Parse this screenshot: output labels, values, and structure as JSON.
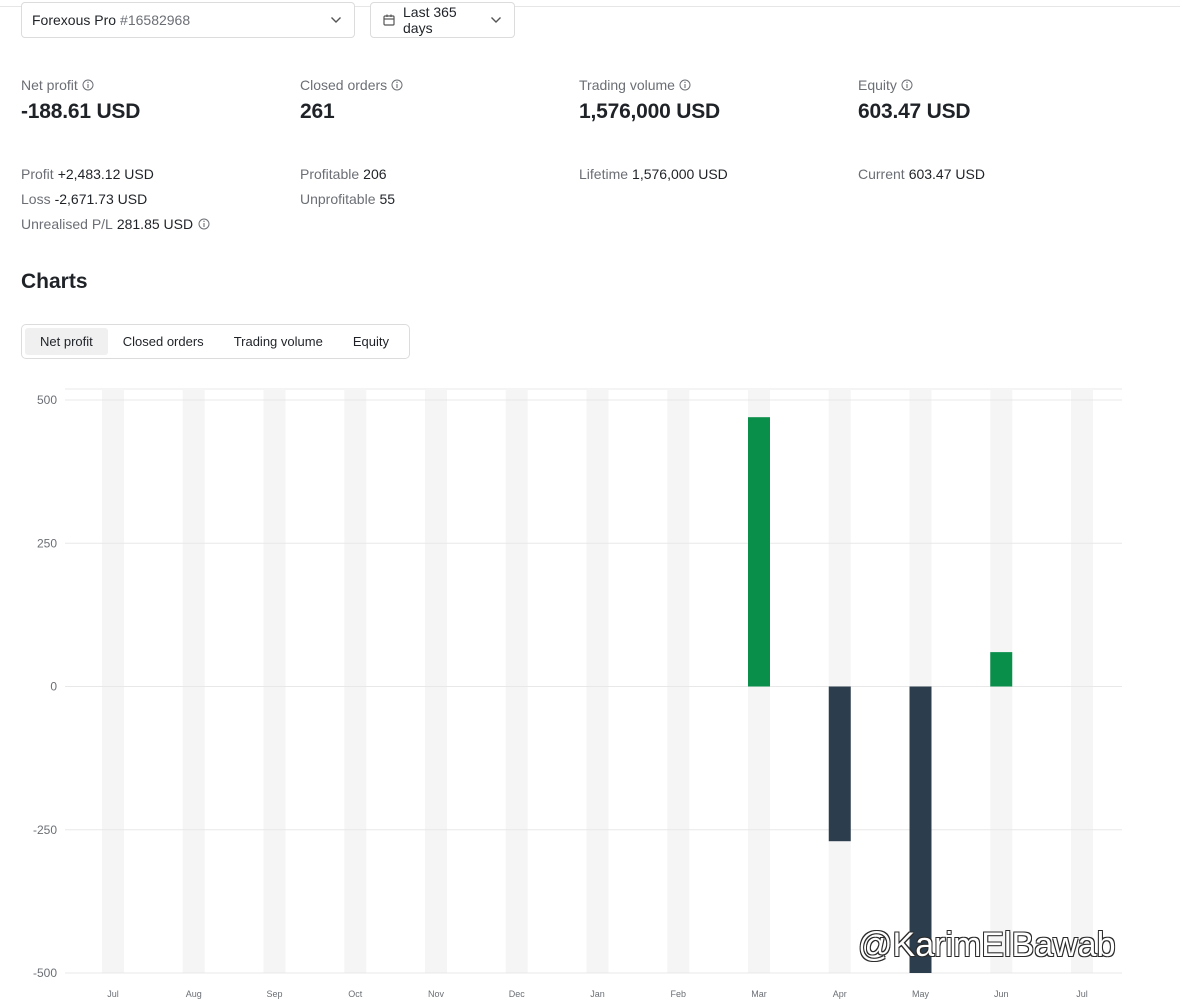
{
  "account": {
    "name": "Forexous Pro",
    "id": "#16582968"
  },
  "period": {
    "label": "Last 365 days"
  },
  "stats": [
    {
      "label": "Net profit",
      "value": "-188.61 USD"
    },
    {
      "label": "Closed orders",
      "value": "261"
    },
    {
      "label": "Trading volume",
      "value": "1,576,000 USD"
    },
    {
      "label": "Equity",
      "value": "603.47 USD"
    }
  ],
  "details": {
    "profit": {
      "label": "Profit",
      "value": "+2,483.12 USD"
    },
    "loss": {
      "label": "Loss",
      "value": "-2,671.73 USD"
    },
    "unrealised": {
      "label": "Unrealised P/L",
      "value": "281.85 USD"
    },
    "profitable": {
      "label": "Profitable",
      "value": "206"
    },
    "unprofitable": {
      "label": "Unprofitable",
      "value": "55"
    },
    "lifetime": {
      "label": "Lifetime",
      "value": "1,576,000 USD"
    },
    "current": {
      "label": "Current",
      "value": "603.47 USD"
    }
  },
  "charts": {
    "title": "Charts",
    "tabs": [
      "Net profit",
      "Closed orders",
      "Trading volume",
      "Equity"
    ],
    "active_tab": 0
  },
  "watermark": "@KarimElBawab",
  "colors": {
    "positive": "#0a8f4b",
    "negative": "#2c3e4d",
    "band": "#f5f5f5",
    "grid": "#e8e8e8"
  },
  "chart_data": {
    "type": "bar",
    "categories": [
      "Jul",
      "Aug",
      "Sep",
      "Oct",
      "Nov",
      "Dec",
      "Jan",
      "Feb",
      "Mar",
      "Apr",
      "May",
      "Jun",
      "Jul"
    ],
    "values": [
      0,
      0,
      0,
      0,
      0,
      0,
      0,
      0,
      470,
      -270,
      -500,
      60,
      0
    ],
    "yticks": [
      500,
      250,
      0,
      -250,
      -500
    ],
    "ylim": [
      -500,
      500
    ],
    "grid": true,
    "title": "",
    "xlabel": "",
    "ylabel": ""
  }
}
